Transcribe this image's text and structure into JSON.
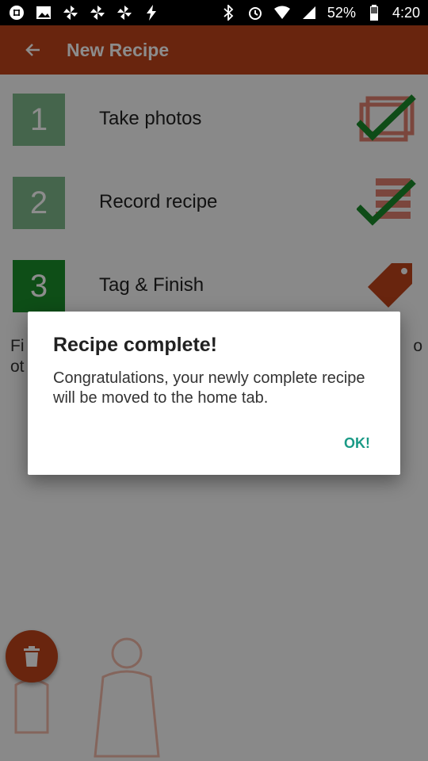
{
  "status_bar": {
    "left_icons": [
      "slack-icon",
      "image-icon",
      "pinwheel-icon",
      "pinwheel-icon",
      "pinwheel-icon",
      "bolt-icon"
    ],
    "battery": "52%",
    "time": "4:20"
  },
  "app_bar": {
    "title": "New Recipe",
    "back_icon": "arrow-back-icon",
    "color": "#c0441a"
  },
  "steps": [
    {
      "number": "1",
      "label": "Take photos",
      "icon": "photo-check-icon",
      "done": true
    },
    {
      "number": "2",
      "label": "Record recipe",
      "icon": "list-check-icon",
      "done": true
    },
    {
      "number": "3",
      "label": "Tag & Finish",
      "icon": "tag-icon",
      "done": false
    }
  ],
  "info_text_fragment": {
    "line1_start": "Fi",
    "line1_end": "o",
    "line2_start": "ot"
  },
  "fab": {
    "icon": "trash-icon"
  },
  "dialog": {
    "title": "Recipe complete!",
    "message": "Congratulations, your newly complete recipe will be moved to the home tab.",
    "button": "OK!",
    "accent": "#1a9a86"
  }
}
